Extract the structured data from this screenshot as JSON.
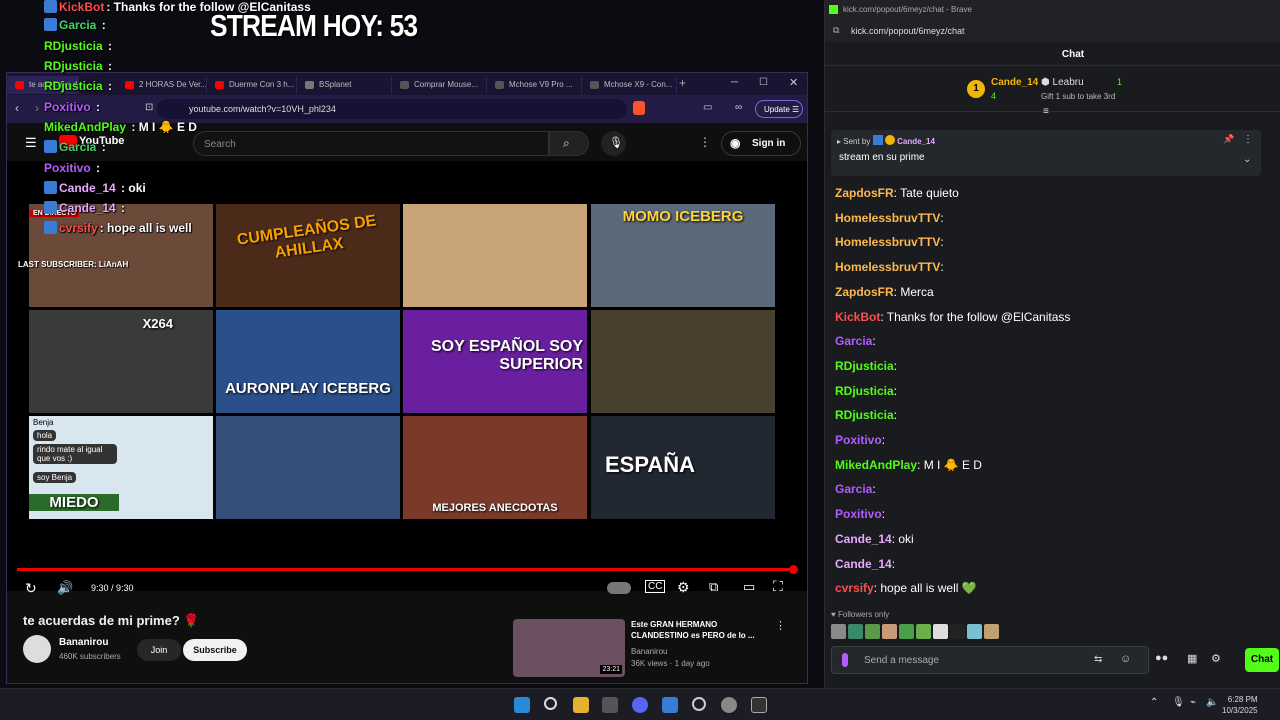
{
  "overlay": {
    "stream_hoy": "STREAM HOY: 53",
    "last_sub": "LAST SUBSCRIBER: LiAnAH",
    "chat": [
      {
        "user": "KickBot",
        "color": "#ff4d4d",
        "text": ": Thanks for the follow @ElCanitass",
        "badge": true
      },
      {
        "user": "Garcia",
        "color": "#3fd46a",
        "text": " :",
        "badge": true
      },
      {
        "user": "RDjusticia",
        "color": "#53fc18",
        "text": " :",
        "badge": false
      },
      {
        "user": "RDjusticia",
        "color": "#53fc18",
        "text": " :",
        "badge": false
      },
      {
        "user": "RDjusticia",
        "color": "#53fc18",
        "text": " :",
        "badge": false
      },
      {
        "user": "Poxitivo",
        "color": "#b35cff",
        "text": " :",
        "badge": false
      },
      {
        "user": "MikedAndPlay",
        "color": "#53fc18",
        "text": " : M I 🐥 E D",
        "badge": false
      },
      {
        "user": "Garcia",
        "color": "#3fd46a",
        "text": " :",
        "badge": true
      },
      {
        "user": "Poxitivo",
        "color": "#b35cff",
        "text": " :",
        "badge": false
      },
      {
        "user": "Cande_14",
        "color": "#e7a9ff",
        "text": " : oki",
        "badge": true
      },
      {
        "user": "Cande_14",
        "color": "#e7a9ff",
        "text": " :",
        "badge": true
      },
      {
        "user": "cvrsify",
        "color": "#ff4d4d",
        "text": ": hope all is well",
        "badge": true
      }
    ]
  },
  "browser": {
    "tabs": [
      "te acuerdas de mi...",
      "2 HORAS De Ver...",
      "Duerme Con 3 h...",
      "BSplanet",
      "Comprar Mouse...",
      "Mchose V9 Pro ...",
      "Mchose X9 - Con..."
    ],
    "url": "youtube.com/watch?v=10VH_phl234",
    "update_label": "Update",
    "search_placeholder": "Search",
    "signin_label": "Sign in",
    "youtube_label": "YouTube",
    "time": "9:30 / 9:30",
    "video_title": "te acuerdas de mi prime? 🌹",
    "channel": "Bananirou",
    "subs": "460K subscribers",
    "join": "Join",
    "subscribe": "Subscribe",
    "thumbs": [
      {
        "cap": "",
        "bg": "#6b4a3a"
      },
      {
        "cap": "CUMPLEAÑOS DE AHILLAX",
        "bg": "#4b2a1a"
      },
      {
        "cap": "",
        "bg": "#c9a47a"
      },
      {
        "cap": "MOMO ICEBERG",
        "bg": "#5a6a7a"
      },
      {
        "cap": "X264",
        "bg": "#3a3a3a"
      },
      {
        "cap": "AURONPLAY ICEBERG",
        "bg": "#2a4f8a"
      },
      {
        "cap": "SOY ESPAÑOL SOY SUPERIOR",
        "bg": "#6a1fa0"
      },
      {
        "cap": "",
        "bg": "#4a4030"
      },
      {
        "cap": "MIEDO",
        "bg": "#d8e6ef"
      },
      {
        "cap": "",
        "bg": "#34507a"
      },
      {
        "cap": "MEJORES ANECDOTAS",
        "bg": "#7a3a2a"
      },
      {
        "cap": "ESPAÑA",
        "bg": "#222831"
      }
    ],
    "thumb_chat": [
      "Benja",
      "hola",
      "rindo mate al igual que vos :)",
      "soy Benja"
    ],
    "rec": {
      "title": "Este GRAN HERMANO CLANDESTINO es PERO de lo ...",
      "channel": "Bananirou",
      "meta": "36K views · 1 day ago",
      "duration": "23:21"
    }
  },
  "kick": {
    "window_title": "kick.com/popout/6meyz/chat - Brave",
    "url": "kick.com/popout/6meyz/chat",
    "chat_header": "Chat",
    "leader1": {
      "name": "Cande_14",
      "count": "4"
    },
    "leader2": {
      "name": "Leabru",
      "count": "1"
    },
    "gift_text": "Gift 1 sub to take 3rd",
    "pinned_by_label": "Sent by",
    "pinned_user": "Cande_14",
    "pinned_text": "stream en su prime",
    "messages": [
      {
        "user": "ZapdosFR",
        "color": "#ffb84d",
        "text": ": Tate quieto"
      },
      {
        "user": "HomelessbruvTTV",
        "color": "#ffb84d",
        "text": ":"
      },
      {
        "user": "HomelessbruvTTV",
        "color": "#ffb84d",
        "text": ":"
      },
      {
        "user": "HomelessbruvTTV",
        "color": "#ffb84d",
        "text": ":"
      },
      {
        "user": "ZapdosFR",
        "color": "#ffb84d",
        "text": ": Merca"
      },
      {
        "user": "KickBot",
        "color": "#ff4d4d",
        "text": ": Thanks for the follow @ElCanitass"
      },
      {
        "user": "Garcia",
        "color": "#b35cff",
        "text": ":"
      },
      {
        "user": "RDjusticia",
        "color": "#53fc18",
        "text": ":"
      },
      {
        "user": "RDjusticia",
        "color": "#53fc18",
        "text": ":"
      },
      {
        "user": "RDjusticia",
        "color": "#53fc18",
        "text": ":"
      },
      {
        "user": "Poxitivo",
        "color": "#b35cff",
        "text": ":"
      },
      {
        "user": "MikedAndPlay",
        "color": "#53fc18",
        "text": ": M I 🐥 E D"
      },
      {
        "user": "Garcia",
        "color": "#b35cff",
        "text": ":"
      },
      {
        "user": "Poxitivo",
        "color": "#b35cff",
        "text": ":"
      },
      {
        "user": "Cande_14",
        "color": "#e7a9ff",
        "text": ": oki"
      },
      {
        "user": "Cande_14",
        "color": "#e7a9ff",
        "text": ":"
      },
      {
        "user": "cvrsify",
        "color": "#ff4d4d",
        "text": ": hope all is well 💚"
      }
    ],
    "followers_only": "Followers only",
    "send_placeholder": "Send a message",
    "chat_button": "Chat"
  },
  "taskbar": {
    "time": "6:28 PM",
    "date": "10/3/2025"
  }
}
